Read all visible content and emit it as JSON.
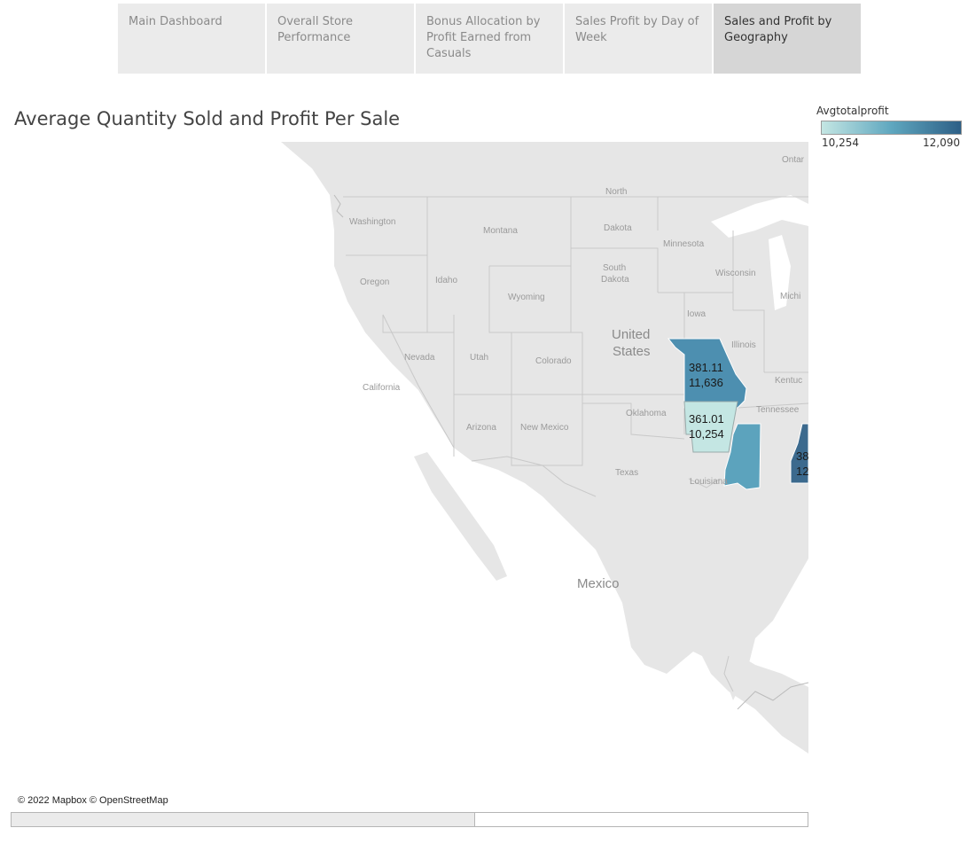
{
  "tabs": [
    {
      "label": "Main Dashboard",
      "active": false
    },
    {
      "label": "Overall Store Performance",
      "active": false
    },
    {
      "label": "Bonus Allocation by Profit Earned from Casuals",
      "active": false
    },
    {
      "label": "Sales Profit by Day of Week",
      "active": false
    },
    {
      "label": "Sales and Profit by Geography",
      "active": true
    }
  ],
  "title": "Average Quantity Sold and Profit Per Sale",
  "legend": {
    "title": "Avgtotalprofit",
    "min_label": "10,254",
    "max_label": "12,090",
    "min": 10254,
    "max": 12090,
    "color_low": "#c4e6e3",
    "color_high": "#2d5f86"
  },
  "map": {
    "basemap_labels": {
      "washington": "Washington",
      "montana": "Montana",
      "north_dakota_1": "North",
      "north_dakota_2": "Dakota",
      "minnesota": "Minnesota",
      "ontario": "Ontar",
      "south_dakota_1": "South",
      "south_dakota_2": "Dakota",
      "wisconsin": "Wisconsin",
      "michigan": "Michi",
      "oregon": "Oregon",
      "idaho": "Idaho",
      "wyoming": "Wyoming",
      "iowa": "Iowa",
      "us_1": "United",
      "us_2": "States",
      "illinois": "Illinois",
      "nevada": "Nevada",
      "utah": "Utah",
      "colorado": "Colorado",
      "kentucky": "Kentuc",
      "california": "California",
      "oklahoma": "Oklahoma",
      "tennessee": "Tennessee",
      "arizona": "Arizona",
      "new_mexico": "New Mexico",
      "texas": "Texas",
      "louisiana": "Louisiana",
      "mexico": "Mexico"
    },
    "regions": [
      {
        "name": "Missouri",
        "value": 11636,
        "qty_label": "381.11",
        "profit_label": "11,636",
        "color": "#4d8fb0"
      },
      {
        "name": "Arkansas",
        "value": 10254,
        "qty_label": "361.01",
        "profit_label": "10,254",
        "color": "#c4e6e3"
      },
      {
        "name": "Mississippi",
        "color": "#5ca3bd"
      },
      {
        "name": "Alabama",
        "value": 12090,
        "qty_label": "38",
        "profit_label": "12",
        "color": "#3c6a8e"
      }
    ],
    "attribution": "© 2022 Mapbox © OpenStreetMap"
  }
}
